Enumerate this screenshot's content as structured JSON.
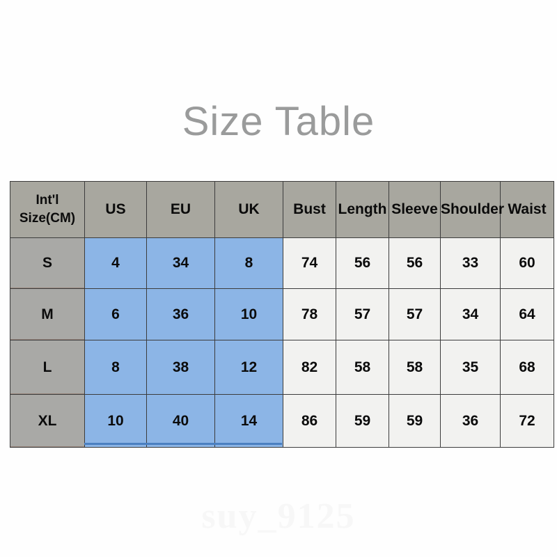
{
  "page": {
    "title": "Size Table",
    "watermark": "suy_9125",
    "background_color": "#fefefe",
    "title_color": "#9a9b9b"
  },
  "colors": {
    "header_gray": "#a8a79f",
    "size_column_gray": "#a9a9a6",
    "blue_cell": "#8cb5e6",
    "plain_cell": "#f2f2f0",
    "border": "#3c3c3c",
    "blue_accent": "#4a7fc1",
    "watermark": "#f7f7f7"
  },
  "table": {
    "headers": [
      "Int'l Size(CM)",
      "US",
      "EU",
      "UK",
      "Bust",
      "Length",
      "Sleeve",
      "Shoulder",
      "Waist"
    ],
    "header_lines": {
      "intl_line1": "Int'l",
      "intl_line2": "Size(CM)"
    },
    "rows": [
      {
        "size": "S",
        "us": "4",
        "eu": "34",
        "uk": "8",
        "bust": "74",
        "length": "56",
        "sleeve": "56",
        "shoulder": "33",
        "waist": "60"
      },
      {
        "size": "M",
        "us": "6",
        "eu": "36",
        "uk": "10",
        "bust": "78",
        "length": "57",
        "sleeve": "57",
        "shoulder": "34",
        "waist": "64"
      },
      {
        "size": "L",
        "us": "8",
        "eu": "38",
        "uk": "12",
        "bust": "82",
        "length": "58",
        "sleeve": "58",
        "shoulder": "35",
        "waist": "68"
      },
      {
        "size": "XL",
        "us": "10",
        "eu": "40",
        "uk": "14",
        "bust": "86",
        "length": "59",
        "sleeve": "59",
        "shoulder": "36",
        "waist": "72"
      }
    ]
  }
}
